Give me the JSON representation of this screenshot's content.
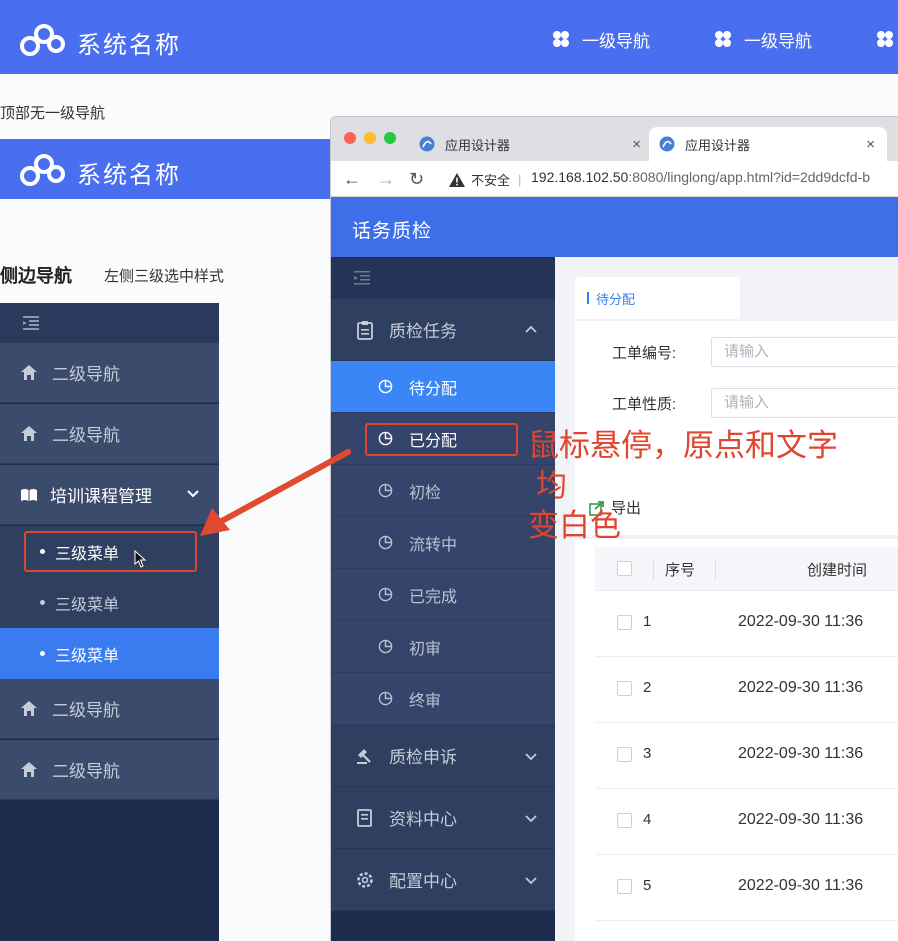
{
  "top_header": {
    "system_name": "系统名称",
    "nav_items": [
      "一级导航",
      "一级导航"
    ]
  },
  "caption_top": "顶部无一级导航",
  "second_header": {
    "system_name": "系统名称"
  },
  "caption_side": {
    "title": "侧边导航",
    "subtitle": "左侧三级选中样式"
  },
  "left_sidebar": {
    "nav_top": [
      "二级导航",
      "二级导航"
    ],
    "group_label": "培训课程管理",
    "sub_items": [
      "三级菜单",
      "三级菜单",
      "三级菜单"
    ],
    "nav_bottom": [
      "二级导航",
      "二级导航"
    ]
  },
  "browser": {
    "tabs": [
      "应用设计器",
      "应用设计器"
    ],
    "close_glyph": "×",
    "insecure_label": "不安全",
    "url_host": "192.168.102.50",
    "url_rest": ":8080/linglong/app.html?id=2dd9dcfd-b"
  },
  "app": {
    "title": "话务质检",
    "menu": {
      "group1": "质检任务",
      "sub_items": [
        "待分配",
        "已分配",
        "初检",
        "流转中",
        "已完成",
        "初审",
        "终审"
      ],
      "group2": "质检申诉",
      "group3": "资料中心",
      "group4": "配置中心"
    },
    "content_tab": "待分配",
    "form": {
      "label1": "工单编号:",
      "label2": "工单性质:",
      "placeholder": "请输入"
    },
    "export_label": "导出",
    "table": {
      "headers": [
        "序号",
        "创建时间"
      ],
      "rows": [
        {
          "num": "1",
          "time": "2022-09-30 11:36"
        },
        {
          "num": "2",
          "time": "2022-09-30 11:36"
        },
        {
          "num": "3",
          "time": "2022-09-30 11:36"
        },
        {
          "num": "4",
          "time": "2022-09-30 11:36"
        },
        {
          "num": "5",
          "time": "2022-09-30 11:36"
        }
      ]
    }
  },
  "annotation": {
    "line1": "鼠标悬停，原点和文字",
    "line2": "均",
    "line3": "变白色"
  },
  "colors": {
    "brand_blue": "#4a6ef0",
    "sidebar_dark": "#1e2c4d",
    "active_blue": "#3a86f7",
    "annotation_red": "#e0452d"
  }
}
